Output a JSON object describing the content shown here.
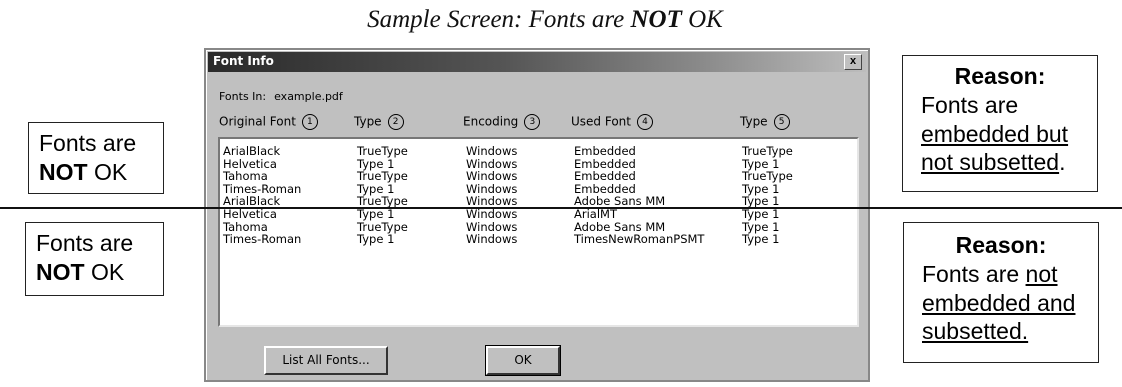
{
  "heading": {
    "prefix": "Sample Screen: Fonts are ",
    "emphasis": "NOT",
    "suffix": " OK"
  },
  "left_callouts": [
    {
      "line1": "Fonts are",
      "bold": "NOT",
      "rest": " OK"
    },
    {
      "line1": "Fonts are",
      "bold": "NOT",
      "rest": " OK"
    }
  ],
  "reason_top": {
    "head": "Reason:",
    "line1": "Fonts are",
    "line2": "embedded but",
    "line3": "not subsetted",
    "punct": "."
  },
  "reason_bottom": {
    "head": "Reason:",
    "line1_plain": "Fonts are ",
    "line1_u": "not",
    "line2": "embedded and",
    "line3": "subsetted."
  },
  "dialog": {
    "title": "Font Info",
    "close": "x",
    "fonts_in_label": "Fonts In:",
    "fonts_in_file": "example.pdf",
    "columns": [
      {
        "label": "Original Font",
        "num": "1"
      },
      {
        "label": "Type",
        "num": "2"
      },
      {
        "label": "Encoding",
        "num": "3"
      },
      {
        "label": "Used Font",
        "num": "4"
      },
      {
        "label": "Type",
        "num": "5"
      }
    ],
    "rows": [
      [
        "ArialBlack",
        "TrueType",
        "Windows",
        "Embedded",
        "TrueType"
      ],
      [
        "Helvetica",
        "Type 1",
        "Windows",
        "Embedded",
        "Type 1"
      ],
      [
        "Tahoma",
        "TrueType",
        "Windows",
        "Embedded",
        "TrueType"
      ],
      [
        "Times-Roman",
        "Type 1",
        "Windows",
        "Embedded",
        "Type 1"
      ],
      [
        "ArialBlack",
        "TrueType",
        "Windows",
        "Adobe Sans MM",
        "Type 1"
      ],
      [
        "Helvetica",
        "Type 1",
        "Windows",
        "ArialMT",
        "Type 1"
      ],
      [
        "Tahoma",
        "TrueType",
        "Windows",
        "Adobe Sans MM",
        "Type 1"
      ],
      [
        "Times-Roman",
        "Type 1",
        "Windows",
        "TimesNewRomanPSMT",
        "Type 1"
      ]
    ],
    "btn_list": "List All Fonts...",
    "btn_ok": "OK"
  }
}
